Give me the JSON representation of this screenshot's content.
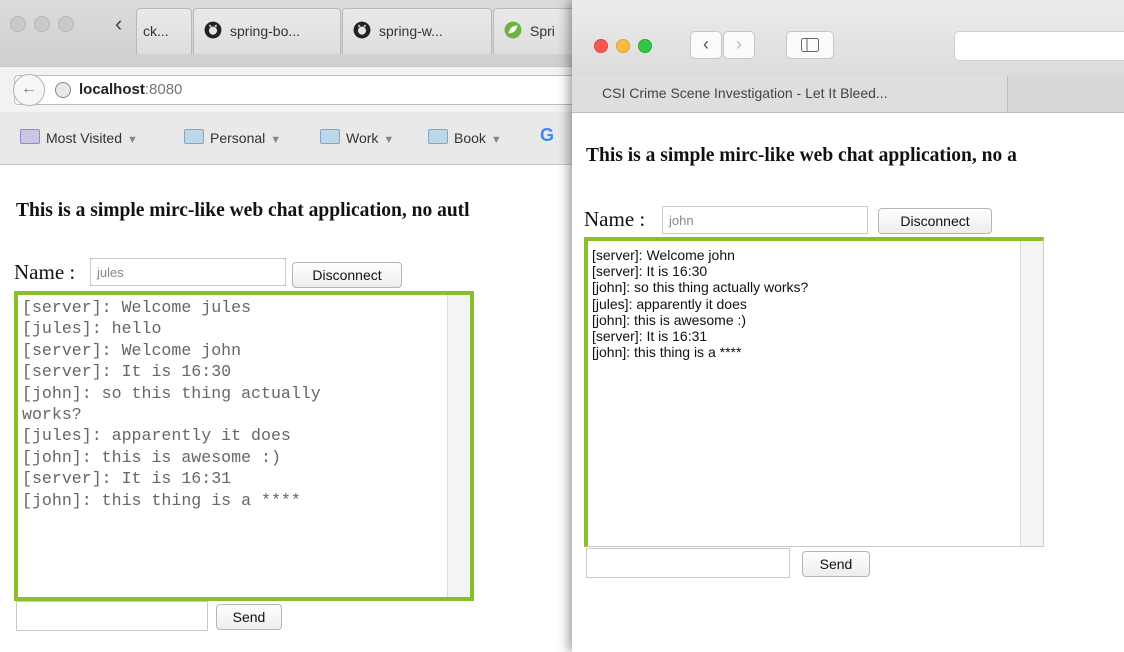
{
  "left_window": {
    "tabs": [
      {
        "label": "ck...",
        "icon": "page-icon"
      },
      {
        "label": "spring-bo...",
        "icon": "github-icon"
      },
      {
        "label": "spring-w...",
        "icon": "github-icon"
      },
      {
        "label": "Spri",
        "icon": "spring-icon"
      }
    ],
    "url": {
      "host": "localhost",
      "port": ":8080"
    },
    "bookmarks": [
      {
        "label": "Most Visited"
      },
      {
        "label": "Personal"
      },
      {
        "label": "Work"
      },
      {
        "label": "Book"
      }
    ],
    "google_glyph": "G",
    "heading": "This is a simple mirc-like web chat application, no autl",
    "name_label": "Name :",
    "name_value": "jules",
    "disconnect_label": "Disconnect",
    "chat_lines": [
      "[server]: Welcome jules",
      "[jules]: hello",
      "[server]: Welcome john",
      "[server]: It is 16:30",
      "[john]: so this thing actually",
      "works?",
      "[jules]: apparently it does",
      "[john]: this is awesome :)",
      "[server]: It is 16:31",
      "[john]: this thing is a ****"
    ],
    "message_value": "",
    "send_label": "Send"
  },
  "right_window": {
    "tab_title": "CSI Crime Scene Investigation - Let It Bleed...",
    "heading": "This is a simple mirc-like web chat application, no a",
    "name_label": "Name :",
    "name_value": "john",
    "disconnect_label": "Disconnect",
    "chat_lines": [
      "[server]: Welcome john",
      "[server]: It is 16:30",
      "[john]: so this thing actually works?",
      "[jules]: apparently it does",
      "[john]: this is awesome :)",
      "[server]: It is 16:31",
      "[john]: this thing is a ****"
    ],
    "message_value": "",
    "send_label": "Send"
  },
  "colors": {
    "chat_border": "#8bbf2a",
    "close_dot": "#fc5753",
    "minimize_dot": "#fdbc40",
    "zoom_dot": "#33c748"
  }
}
